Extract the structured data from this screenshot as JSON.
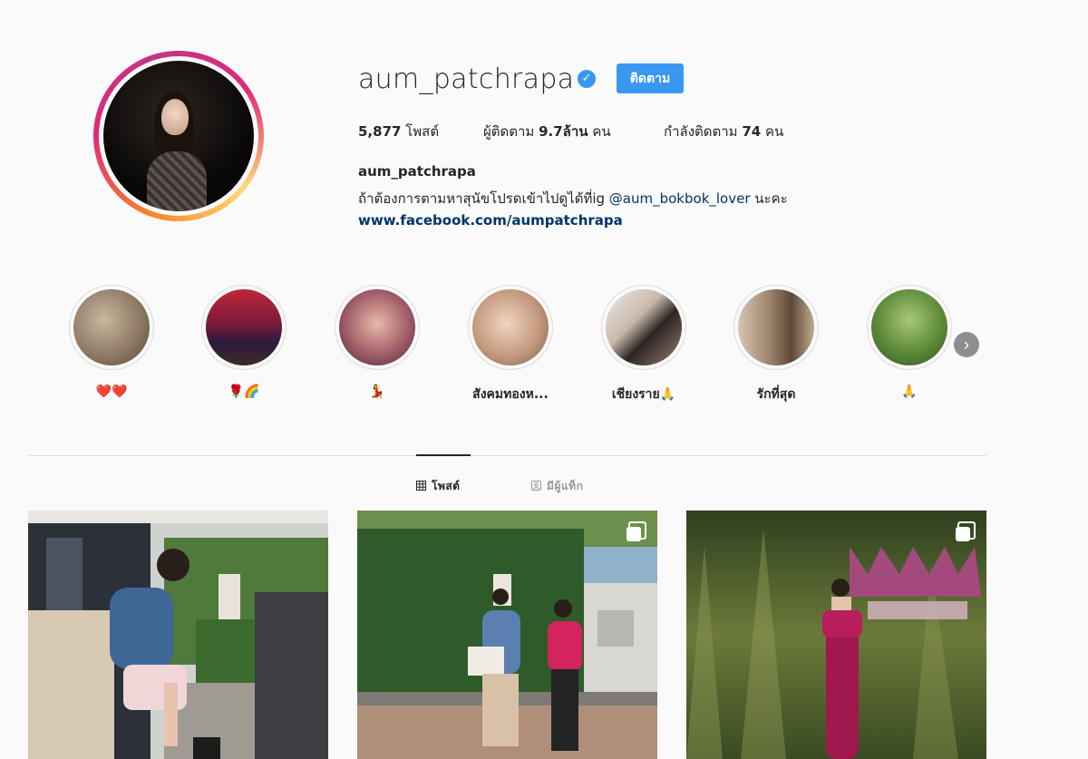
{
  "profile": {
    "username": "aum_patchrapa",
    "follow_label": "ติดตาม",
    "verified": true,
    "stats": {
      "posts_count": "5,877",
      "posts_label": "โพสต์",
      "followers_label": "ผู้ติดตาม",
      "followers_count": "9.7ล้าน",
      "followers_unit": "คน",
      "following_label": "กำลังติดตาม",
      "following_count": "74",
      "following_unit": "คน"
    },
    "bio": {
      "name": "aum_patchrapa",
      "text_before": "ถ้าต้องการตามหาสุนัขโปรดเข้าไปดูได้ที่ig ",
      "mention": "@aum_bokbok_lover",
      "text_after": " นะคะ",
      "link": "www.facebook.com/aumpatchrapa"
    }
  },
  "highlights": [
    {
      "label": "❤️❤️"
    },
    {
      "label": "🌹🌈"
    },
    {
      "label": "💃"
    },
    {
      "label": "สังคมทองห..."
    },
    {
      "label": "เชียงราย🙏"
    },
    {
      "label": "รักที่สุด"
    },
    {
      "label": "🙏"
    }
  ],
  "tabs": {
    "posts": "โพสต์",
    "tagged": "มีผู้แท็ก"
  },
  "colors": {
    "accent": "#3897f0",
    "link": "#003569",
    "background": "#fafafa",
    "divider": "#dbdbdb"
  },
  "icons": {
    "verified": "verified-badge-icon",
    "next": "chevron-right-icon",
    "grid": "grid-icon",
    "tagged": "tagged-user-icon",
    "multi": "multiple-photos-icon"
  }
}
